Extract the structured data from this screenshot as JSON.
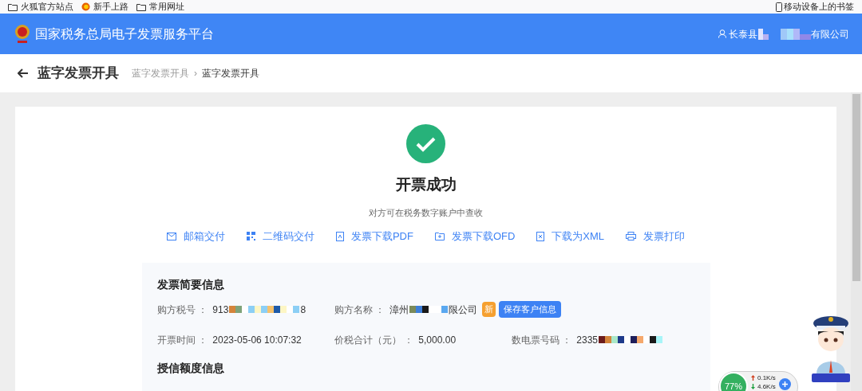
{
  "bookmarks": [
    {
      "kind": "folder",
      "label": "火狐官方站点"
    },
    {
      "kind": "firefox",
      "label": "新手上路"
    },
    {
      "kind": "folder",
      "label": "常用网址"
    }
  ],
  "mobile_bookmarks": "移动设备上的书签",
  "header": {
    "title": "国家税务总局电子发票服务平台",
    "user_prefix": "长泰县",
    "user_suffix": "有限公司"
  },
  "page_title": "蓝字发票开具",
  "breadcrumb_separator": "›",
  "breadcrumb": [
    {
      "label": "蓝字发票开具",
      "current": false
    },
    {
      "label": "蓝字发票开具",
      "current": true
    }
  ],
  "result": {
    "title": "开票成功",
    "subtitle": "对方可在税务数字账户中查收"
  },
  "actions": [
    {
      "kind": "mail",
      "label": "邮箱交付"
    },
    {
      "kind": "qr",
      "label": "二维码交付"
    },
    {
      "kind": "pdf",
      "label": "发票下载PDF"
    },
    {
      "kind": "ofd",
      "label": "发票下载OFD"
    },
    {
      "kind": "xml",
      "label": "下载为XML"
    },
    {
      "kind": "print",
      "label": "发票打印"
    }
  ],
  "summary": {
    "title": "发票简要信息",
    "fields": [
      {
        "label": "购方税号 ：",
        "value": "913",
        "value_end": "8",
        "redacted": true
      },
      {
        "label": "购方名称 ：",
        "value": "漳州",
        "value_end": "限公司",
        "redacted": true,
        "badge": "新",
        "button": "保存客户信息"
      },
      {
        "label": "开票时间 ：",
        "value": "2023-05-06 10:07:32",
        "redacted": false
      },
      {
        "label": "价税合计（元） ：",
        "value": "5,000.00",
        "redacted": false
      },
      {
        "label": "数电票号码 ：",
        "value": "2335",
        "redacted": true
      }
    ]
  },
  "credit_title": "授信额度信息",
  "net_widget": {
    "percent": "77%",
    "upload": "0.1K/s",
    "download": "4.6K/s"
  }
}
